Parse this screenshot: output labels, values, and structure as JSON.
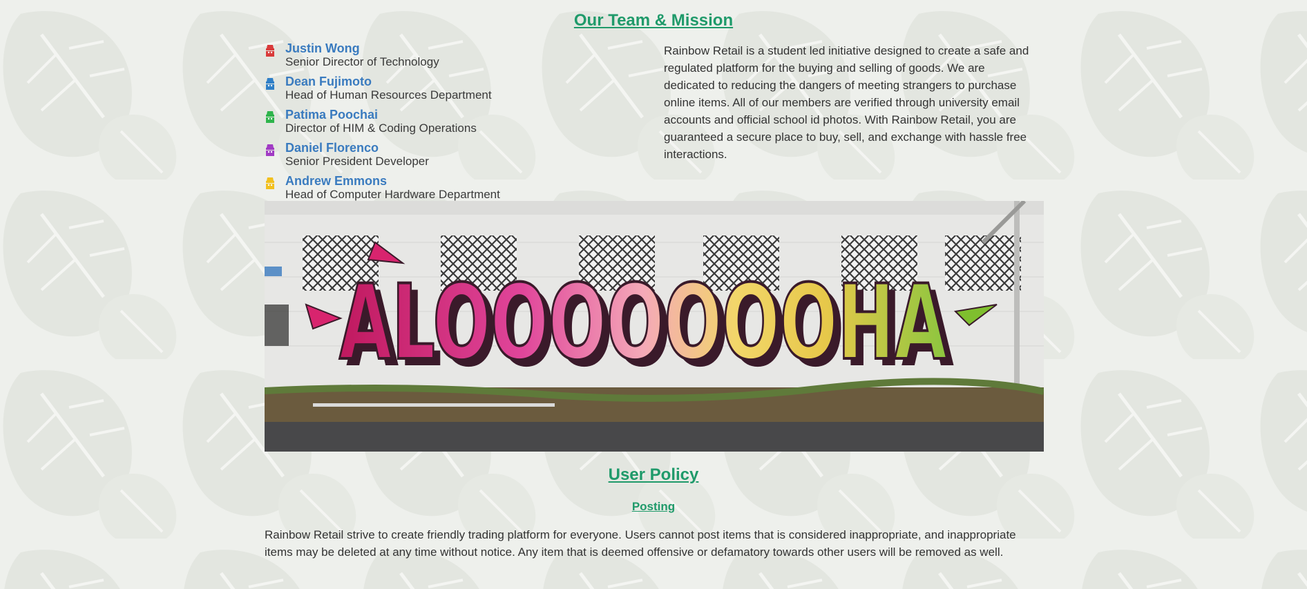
{
  "team_section": {
    "title": "Our Team & Mission",
    "members": [
      {
        "name": "Justin Wong",
        "role": "Senior Director of Technology",
        "icon": "user-icon",
        "color": "#d93a3a"
      },
      {
        "name": "Dean Fujimoto",
        "role": "Head of Human Resources Department",
        "icon": "user-icon",
        "color": "#2f7fc7"
      },
      {
        "name": "Patima Poochai",
        "role": "Director of HIM & Coding Operations",
        "icon": "user-icon",
        "color": "#2fb44c"
      },
      {
        "name": "Daniel Florenco",
        "role": "Senior President Developer",
        "icon": "user-icon",
        "color": "#a13bc4"
      },
      {
        "name": "Andrew Emmons",
        "role": "Head of Computer Hardware Department",
        "icon": "user-icon",
        "color": "#f2c01e"
      }
    ],
    "mission_text": "Rainbow Retail is a student led initiative designed to create a safe and regulated platform for the buying and selling of goods. We are dedicated to reducing the dangers of meeting strangers to purchase online items. All of our members are verified through university email accounts and official school id photos. With Rainbow Retail, you are guaranteed a secure place to buy, sell, and exchange with hassle free interactions."
  },
  "banner": {
    "text": "ALOOOOOOOHA",
    "gradient": [
      "#c0195f",
      "#e0459a",
      "#f4a9b8",
      "#f2d66a",
      "#e7c84a",
      "#8cc63f"
    ]
  },
  "policy_section": {
    "title": "User Policy",
    "posting_title": "Posting",
    "posting_text": "Rainbow Retail strive to create friendly trading platform for everyone. Users cannot post items that is considered inappropriate, and inappropriate items may be deleted at any time without notice. Any item that is deemed offensive or defamatory towards other users will be removed as well."
  },
  "colors": {
    "heading": "#1f9a6a",
    "member_name": "#3a7bbf",
    "background": "#eef0ec"
  }
}
